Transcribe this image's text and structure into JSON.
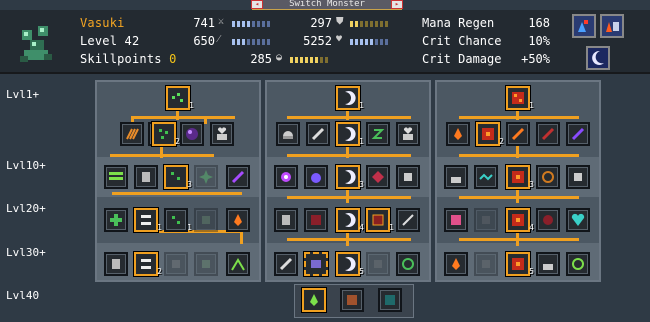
{
  "tab": {
    "title": "Switch Monster"
  },
  "monster": {
    "name": "Vasuki",
    "level_label": "Level 42",
    "skillpoints_label": "Skillpoints",
    "skillpoints_value": "0"
  },
  "stats": {
    "attack": "741",
    "defense": "297",
    "magic": "650",
    "health": "5252",
    "mana": "285",
    "attack_bar": 0.6,
    "defense_bar": 0.4,
    "magic_bar": 0.5,
    "health_bar": 0.7,
    "mana_bar": 0.8
  },
  "secondary": {
    "mana_regen_label": "Mana Regen",
    "mana_regen_value": "168",
    "crit_chance_label": "Crit Chance",
    "crit_chance_value": "10%",
    "crit_damage_label": "Crit Damage",
    "crit_damage_value": "+50%"
  },
  "levels": [
    "Lvl1+",
    "Lvl10+",
    "Lvl20+",
    "Lvl30+",
    "Lvl40"
  ],
  "skill_counts": {
    "t1_root": "1",
    "t1_b": "2",
    "t1_10c": "3",
    "t1_20b": "1",
    "t1_20c": "1",
    "t1_30b": "2",
    "t2_root": "1",
    "t2_b": "1",
    "t2_10c": "3",
    "t2_20c": "4",
    "t2_20e": "1",
    "t2_30c": "5",
    "t3_root": "1",
    "t3_b": "2",
    "t3_10c": "3",
    "t3_20c": "4",
    "t3_30c": "5"
  },
  "colors": {
    "accent": "#f0a020",
    "name": "#f5a623",
    "skillpoints": "#f5c518"
  }
}
